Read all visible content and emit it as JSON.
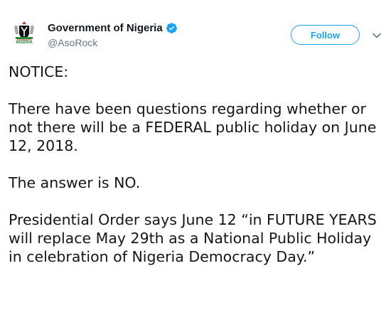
{
  "author": {
    "display_name": "Government of Nigeria",
    "screen_name": "@AsoRock",
    "verified": true,
    "avatar_icon": "nigeria-coat-of-arms-icon",
    "avatar_caption": "NIGERIA"
  },
  "follow_button": {
    "label": "Follow"
  },
  "menu": {
    "icon": "chevron-down-icon"
  },
  "tweet": {
    "paragraphs": [
      "NOTICE:",
      "There have been questions regarding whether or not there will be a FEDERAL public holiday on June 12, 2018.",
      "The answer is NO.",
      "Presidential Order says June 12 “in FUTURE YEARS will replace May 29th as a National Public Holiday in celebration of Nigeria Democracy Day.”"
    ]
  },
  "colors": {
    "accent": "#1da1f2",
    "text_primary": "#14171a",
    "text_secondary": "#657786",
    "coat_green": "#2e8b3a",
    "coat_red": "#c0392b"
  }
}
